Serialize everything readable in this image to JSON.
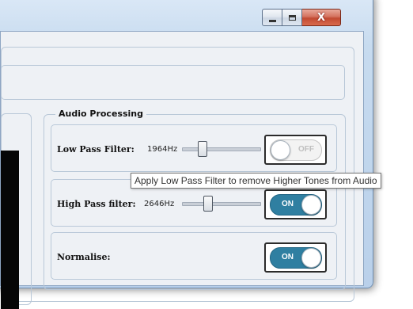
{
  "window": {
    "caption_buttons": {
      "minimize": "minimize",
      "maximize": "maximize",
      "close": "X"
    }
  },
  "audio_processing": {
    "title": "Audio Processing",
    "low_pass": {
      "label": "Low Pass Filter:",
      "frequency": "1964Hz",
      "slider_level": 0.25,
      "toggle": "OFF"
    },
    "high_pass": {
      "label": "High Pass filter:",
      "frequency": "2646Hz",
      "slider_level": 0.33,
      "toggle": "ON"
    },
    "normalise": {
      "label": "Normalise:",
      "toggle": "ON"
    }
  },
  "tooltip": {
    "text": "Apply Low Pass Filter to remove Higher Tones from Audio"
  },
  "colors": {
    "toggle_on": "#2f7fa1",
    "toggle_off": "#f3f3f3",
    "panel_background": "#eef1f5"
  }
}
